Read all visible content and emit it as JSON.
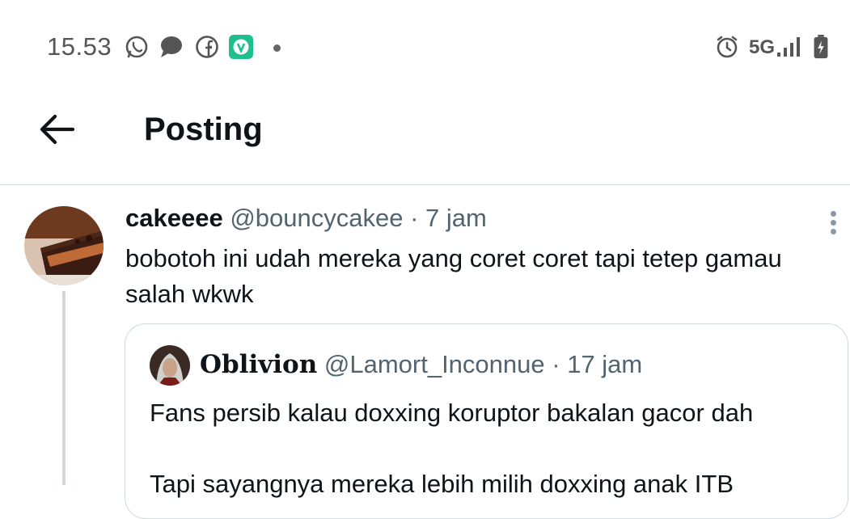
{
  "status_bar": {
    "time": "15.53",
    "network": "5G",
    "icons": [
      "whatsapp-icon",
      "chat-bubble-icon",
      "facebook-icon",
      "vidio-app-icon",
      "notification-dot",
      "alarm-icon",
      "signal-icon",
      "battery-charging-icon"
    ]
  },
  "header": {
    "title": "Posting",
    "back_icon": "arrow-left-icon"
  },
  "post": {
    "display_name": "cakeeee",
    "handle": "@bouncycakee",
    "separator": "·",
    "time": "7 jam",
    "text": "bobotoh ini udah mereka yang coret coret tapi tetep gamau salah wkwk",
    "more_icon": "more-vertical-icon"
  },
  "quote": {
    "display_name": "Oblivion",
    "handle": "@Lamort_Inconnue",
    "separator": "·",
    "time": "17 jam",
    "text_line1": "Fans persib kalau doxxing koruptor bakalan gacor dah",
    "text_line2": "Tapi sayangnya mereka lebih milih doxxing anak ITB"
  },
  "colors": {
    "text_primary": "#0f1419",
    "text_secondary": "#536471",
    "border": "#cfd9de",
    "vidio_green": "#1dbf8f"
  }
}
